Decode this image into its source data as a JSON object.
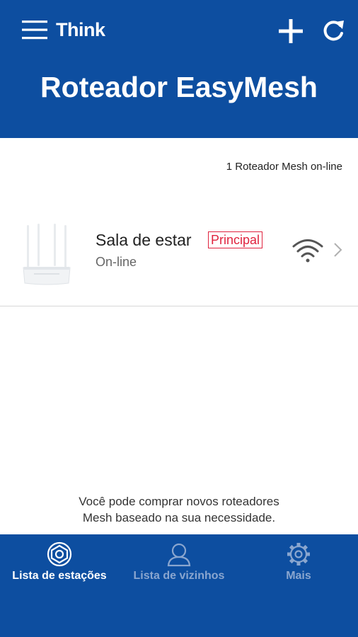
{
  "header": {
    "brand": "Think",
    "title": "Roteador EasyMesh",
    "menu_icon": "hamburger-menu-icon",
    "add_icon": "plus-icon",
    "refresh_icon": "refresh-icon",
    "background_color": "#0d4ea0"
  },
  "mesh_status": "1 Roteador Mesh on-line",
  "routers": [
    {
      "name": "Sala de estar",
      "badge": "Principal",
      "status": "On-line",
      "icon": "router-icon",
      "signal_icon": "wifi-signal-icon",
      "badge_color": "#e0243f"
    }
  ],
  "info": {
    "line1": "Você pode comprar novos roteadores",
    "line2": "Mesh baseado na sua necessidade."
  },
  "tabs": [
    {
      "label": "Lista de estações",
      "icon": "stations-icon",
      "active": true
    },
    {
      "label": "Lista de vizinhos",
      "icon": "person-icon",
      "active": false
    },
    {
      "label": "Mais",
      "icon": "gear-icon",
      "active": false
    }
  ]
}
